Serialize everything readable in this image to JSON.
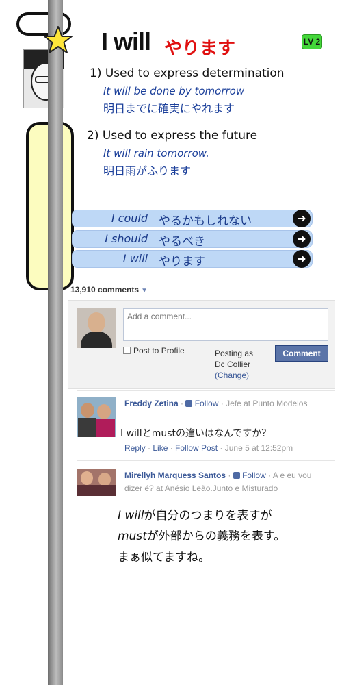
{
  "title": {
    "english": "I will",
    "japanese": "やります",
    "level_badge": "LV 2"
  },
  "usages": [
    {
      "heading": "1) Used to express determination",
      "example_en": "It will be done by tomorrow",
      "example_jp": "明日までに確実にやれます"
    },
    {
      "heading": "2) Used to express the future",
      "example_en": "It will rain tomorrow.",
      "example_jp": "明日雨がふります"
    }
  ],
  "related_phrases": [
    {
      "english": "I could",
      "japanese": "やるかもしれない"
    },
    {
      "english": "I should",
      "japanese": "やるべき"
    },
    {
      "english": "I will",
      "japanese": "やります"
    }
  ],
  "comments_section": {
    "count_label": "13,910 comments",
    "input_placeholder": "Add a comment...",
    "post_to_profile_label": "Post to Profile",
    "posting_as_label": "Posting as",
    "posting_as_name": "Dc Collier",
    "change_label": "(Change)",
    "comment_button_label": "Comment",
    "comments": [
      {
        "author": "Freddy Zetina",
        "follow_label": "Follow",
        "author_info": "Jefe at Punto Modelos",
        "body": "I willとmustの違いはなんですか？",
        "reply_label": "Reply",
        "like_label": "Like",
        "follow_post_label": "Follow Post",
        "timestamp": "June 5 at 12:52pm"
      },
      {
        "author": "Mirellyh Marquess Santos",
        "follow_label": "Follow",
        "author_info": "A e eu vou dizer é? at Anésio Leão.Junto e Misturado"
      }
    ]
  },
  "answer": {
    "line1_em": "I will",
    "line1_rest": "が自分のつまりを表すが",
    "line2_em": "must",
    "line2_rest": "が外部からの義務を表す。",
    "line3": "まぁ似てますね。"
  },
  "colors": {
    "title_jp": "#e01010",
    "level_badge": "#44d63a",
    "example_text": "#1b3f9a",
    "related_bar": "#bed8f6",
    "facebook_link": "#3b5998",
    "comment_button": "#5b74a8",
    "comic_panel": "#fcfcbf"
  }
}
